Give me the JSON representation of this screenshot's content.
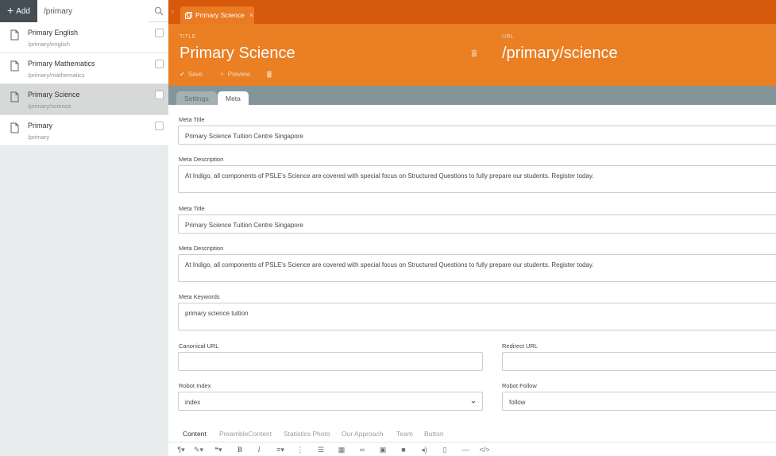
{
  "sidebar": {
    "add_label": "Add",
    "search_value": "/primary",
    "items": [
      {
        "name": "Primary English",
        "path": "/primary/english"
      },
      {
        "name": "Primary Mathematics",
        "path": "/primary/mathematics"
      },
      {
        "name": "Primary Science",
        "path": "/primary/science"
      },
      {
        "name": "Primary",
        "path": "/primary"
      }
    ]
  },
  "tab": {
    "label": "Primary Science"
  },
  "header": {
    "title_label": "TITLE",
    "title": "Primary Science",
    "url_label": "URL",
    "url": "/primary/science",
    "save_label": "Save",
    "preview_label": "Preview"
  },
  "subtabs": {
    "settings": "Settings",
    "meta": "Meta"
  },
  "form": {
    "meta_title_label": "Meta Title",
    "meta_title": "Primary Science Tuition Centre Singapore",
    "meta_description_label": "Meta Description",
    "meta_description": "At Indigo, all components of PSLE's Science are covered with special focus on Structured Questions to fully prepare our students. Register today.",
    "meta_title_label_2": "Meta Title",
    "meta_title_2": "Primary Science Tuition Centre Singapore",
    "meta_description_label_2": "Meta Description",
    "meta_description_2": "At Indigo, all components of PSLE's Science are covered with special focus on Structured Questions to fully prepare our students. Register today.",
    "meta_keywords_label": "Meta Keywords",
    "meta_keywords": "primary science tuition",
    "canonical_url_label": "Canonical URL",
    "canonical_url": "",
    "redirect_url_label": "Redirect URL",
    "redirect_url": "",
    "robot_index_label": "Robot Index",
    "robot_index": "index",
    "robot_follow_label": "Robot Follow",
    "robot_follow": "follow"
  },
  "editor_tabs": [
    "Content",
    "PreambleContent",
    "Statistics Photo",
    "Our Approach",
    "Team",
    "Button"
  ]
}
